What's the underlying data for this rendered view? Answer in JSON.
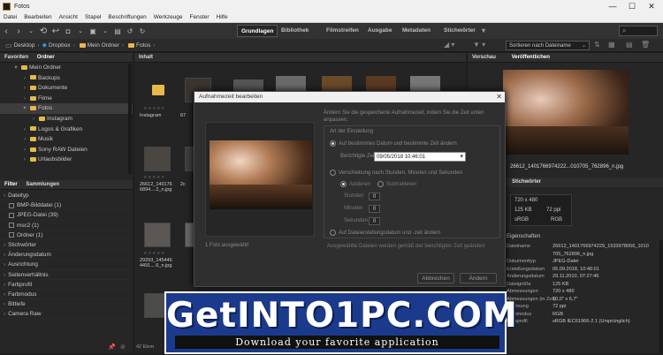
{
  "window": {
    "title": "Fotos",
    "minimize": "—",
    "maximize": "☐",
    "close": "✕"
  },
  "menu": [
    "Datei",
    "Bearbeiten",
    "Ansicht",
    "Stapel",
    "Beschriftungen",
    "Werkzeuge",
    "Fenster",
    "Hilfe"
  ],
  "workspaces": [
    "Grundlagen",
    "Bibliothek",
    "Filmstreifen",
    "Ausgabe",
    "Metadaten",
    "Stichwörter"
  ],
  "path": [
    "Desktop",
    "Dropbox",
    "Mein Ordner",
    "Fotos"
  ],
  "sort_label": "Sortieren nach Dateiname",
  "left_tabs": {
    "favorites": "Favoriten",
    "folders": "Ordner"
  },
  "folder_tree": [
    {
      "label": "Mein Ordner",
      "level": 0,
      "expanded": true
    },
    {
      "label": "Backups",
      "level": 1
    },
    {
      "label": "Dokumente",
      "level": 1
    },
    {
      "label": "Filme",
      "level": 1
    },
    {
      "label": "Fotos",
      "level": 1,
      "selected": true,
      "expanded": true
    },
    {
      "label": "Instagram",
      "level": 2
    },
    {
      "label": "Logos & Grafiken",
      "level": 1
    },
    {
      "label": "Musik",
      "level": 1
    },
    {
      "label": "Sony RAW Dateien",
      "level": 1
    },
    {
      "label": "Urlaubsbilder",
      "level": 1
    }
  ],
  "filter_tabs": {
    "filter": "Filter",
    "collections": "Sammlungen"
  },
  "filters": [
    {
      "label": "Dateityp",
      "header": true
    },
    {
      "label": "BMP-Bilddatei (1)"
    },
    {
      "label": "JPEG-Datei (39)"
    },
    {
      "label": "msc2 (1)"
    },
    {
      "label": "Ordner (1)"
    },
    {
      "label": "Stichwörter",
      "header": true
    },
    {
      "label": "Änderungsdatum",
      "header": true
    },
    {
      "label": "Ausrichtung",
      "header": true
    },
    {
      "label": "Seitenverhältnis",
      "header": true
    },
    {
      "label": "Farbprofil",
      "header": true
    },
    {
      "label": "Farbmodus",
      "header": true
    },
    {
      "label": "Bittiefe",
      "header": true
    },
    {
      "label": "Camera Raw",
      "header": true
    }
  ],
  "content": {
    "tab": "Inhalt",
    "thumbs": [
      {
        "name": "Instagram",
        "folder": true
      },
      {
        "name": "26612_140176\n6894....2_n.jpg"
      },
      {
        "name": "29293_145446\n4491....6_n.jpg"
      }
    ],
    "partial_names": [
      "67",
      "2c"
    ],
    "status": "42 Elem"
  },
  "right": {
    "preview_tab": "Vorschau",
    "publish_tab": "Veröffentlichen",
    "preview_name": "26612_1401766974222...010705_762896_n.jpg",
    "keywords_tab": "Stichwörter",
    "info": {
      "dims": "720 x 480",
      "size": "125 KB",
      "ppi": "72 ppi",
      "mode": "sRGB",
      "rgb": "RGB"
    },
    "meta_header": "Eigenschaften",
    "meta": [
      {
        "k": "Dateiname",
        "v": "26612_1401766974229_1533978056_1010\n705_762896_n.jpg"
      },
      {
        "k": "Dokumenttyp",
        "v": "JPEG-Datei"
      },
      {
        "k": "Erstellungsdatum",
        "v": "05.09.2018, 10:46:01"
      },
      {
        "k": "Änderungsdatum",
        "v": "29.11.2010, 07:27:46"
      },
      {
        "k": "Dateigröße",
        "v": "125 KB"
      },
      {
        "k": "Abmessungen",
        "v": "720 x 480"
      },
      {
        "k": "Abmessungen (in Zoll)",
        "v": "10,0\" x 6,7\""
      },
      {
        "k": "Auflösung",
        "v": "72 ppi"
      },
      {
        "k": "Farbmodus",
        "v": "RGB"
      },
      {
        "k": "Farbprofil",
        "v": "sRGB IEC61966-2.1 (Ursprünglich)"
      }
    ]
  },
  "dialog": {
    "title": "Aufnahmezeit bearbeiten",
    "close": "✕",
    "description": "Ändern Sie die gespeicherte Aufnahmezeit, indem Sie die Zeit unten anpassen.",
    "section": "Art der Einstellung",
    "opt1": "Auf bestimmtes Datum und bestimmte Zeit ändern",
    "field_label": "Berichtigte Zeit",
    "field_value": "09/05/2018  10:46:01",
    "opt2": "Verschiebung nach Stunden, Minuten und Sekunden",
    "add": "Addieren",
    "subtract": "Subtrahieren",
    "hours": "Stunden",
    "minutes": "Minuten",
    "seconds": "Sekunden",
    "zero": "0",
    "opt3": "Auf Dateierstellungsdatum und -zeit ändern",
    "selected_count": "1 Foto ausgewählt",
    "footer_note": "Ausgewählte Dateien werden gemäß der berichtigten Zeit geändert",
    "cancel": "Abbrechen",
    "ok": "Ändern"
  },
  "watermark": {
    "main": "GetINTO1PC.COM",
    "sub": "Download your favorite application"
  }
}
